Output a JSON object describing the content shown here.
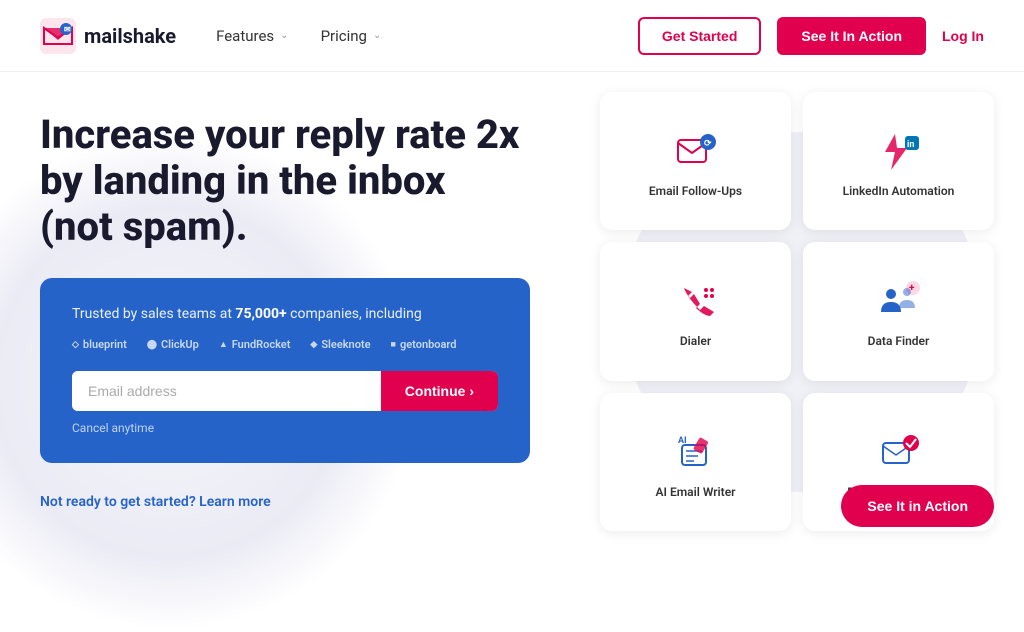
{
  "navbar": {
    "logo_text": "mailshake",
    "logo_trademark": "®",
    "nav_items": [
      {
        "label": "Features",
        "has_chevron": true
      },
      {
        "label": "Pricing",
        "has_chevron": false
      }
    ],
    "btn_get_started": "Get Started",
    "btn_see_action": "See It In Action",
    "btn_login": "Log In"
  },
  "hero": {
    "headline": "Increase your reply rate 2x by landing in the inbox (not spam).",
    "cta_box": {
      "trusted_text": "Trusted by sales teams at ",
      "trusted_highlight": "75,000+",
      "trusted_suffix": " companies, including",
      "companies": [
        "blueprint",
        "ClickUp",
        "FundRocket",
        "Sleeknote",
        "getonboard"
      ],
      "email_placeholder": "Email address",
      "continue_label": "Continue ›",
      "cancel_label": "Cancel anytime"
    },
    "not_ready_text": "Not ready to get started? Learn more"
  },
  "features": [
    {
      "id": "email-followups",
      "label": "Email Follow-Ups",
      "icon": "email-followup"
    },
    {
      "id": "linkedin-automation",
      "label": "LinkedIn Automation",
      "icon": "linkedin"
    },
    {
      "id": "dialer",
      "label": "Dialer",
      "icon": "dialer"
    },
    {
      "id": "data-finder",
      "label": "Data Finder",
      "icon": "data-finder"
    },
    {
      "id": "ai-email-writer",
      "label": "AI Email Writer",
      "icon": "ai-writer"
    },
    {
      "id": "email-deliverability",
      "label": "Email Deliverability",
      "icon": "deliverability"
    }
  ],
  "floating": {
    "label": "See It in Action"
  }
}
